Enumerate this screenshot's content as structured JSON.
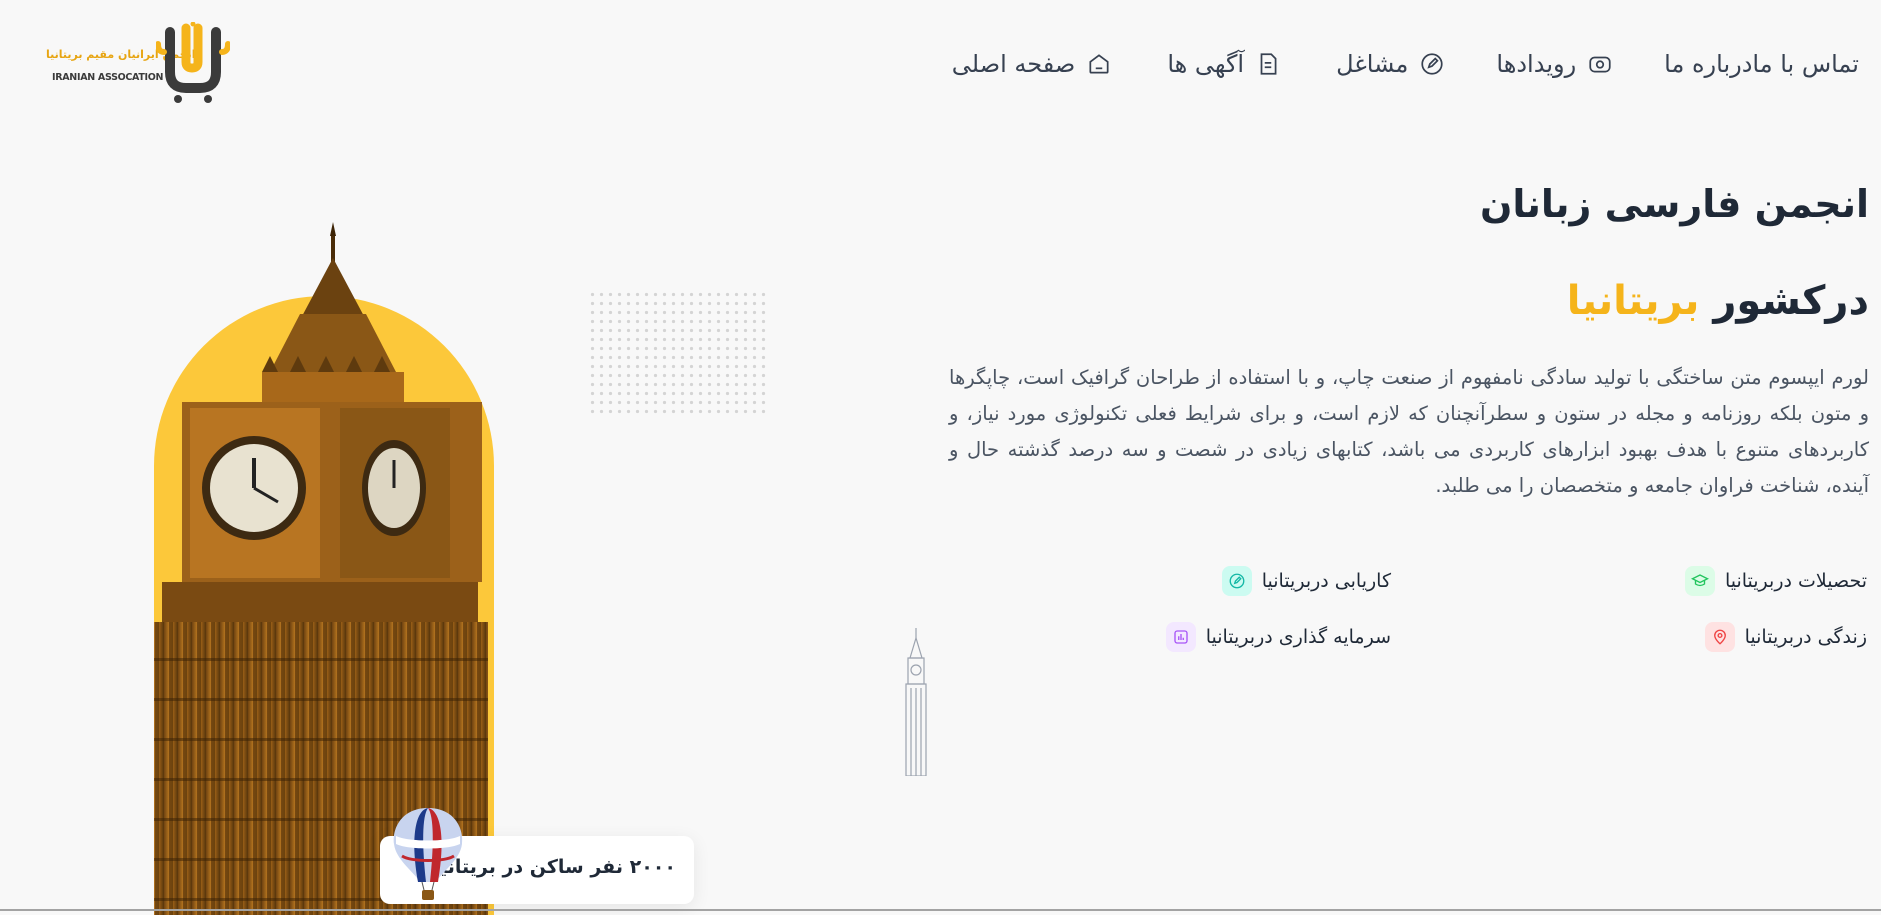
{
  "logo": {
    "persian_text": "انجمن ایرانیان مقیم بریتانیا",
    "english_text": "IRANIAN ASSOCATION"
  },
  "nav": {
    "home": "صفحه اصلی",
    "ads": "آگهی ها",
    "jobs": "مشاغل",
    "events": "رویدادها",
    "about": "درباره ما",
    "contact": "تماس با ما"
  },
  "hero": {
    "title": "انجمن  فارسی زبانان",
    "subtitle_prefix": "درکشور ",
    "subtitle_accent": "بریتانیا",
    "description": "لورم ایپسوم متن ساختگی با تولید سادگی نامفهوم از صنعت چاپ، و با استفاده از طراحان گرافیک است، چاپگرها و متون بلکه روزنامه و مجله در ستون و سطرآنچنان که لازم است، و برای شرایط فعلی تکنولوژی مورد نیاز، و کاربردهای متنوع با هدف بهبود ابزارهای کاربردی می باشد، کتابهای زیادی در شصت و سه درصد گذشته حال و آینده، شناخت فراوان جامعه و متخصصان را می طلبد."
  },
  "features": [
    {
      "label": "تحصیلات  دربریتانیا",
      "icon": "graduation-icon",
      "color": "#22c55e",
      "bg": "#dcfce7"
    },
    {
      "label": "کاریابی دربریتانیا",
      "icon": "edit-icon",
      "color": "#14b8a6",
      "bg": "#ccfbf1"
    },
    {
      "label": "زندگی دربریتانیا",
      "icon": "location-pin-icon",
      "color": "#ef4444",
      "bg": "#fee2e2"
    },
    {
      "label": "سرمایه گذاری دربریتانیا",
      "icon": "chart-icon",
      "color": "#a855f7",
      "bg": "#f3e8ff"
    }
  ],
  "badge": {
    "text": "۲۰۰۰ نفر ساکن در بریتانیا"
  },
  "colors": {
    "accent": "#f5b41b",
    "arch": "#fcc83a",
    "text": "#1f2937"
  }
}
